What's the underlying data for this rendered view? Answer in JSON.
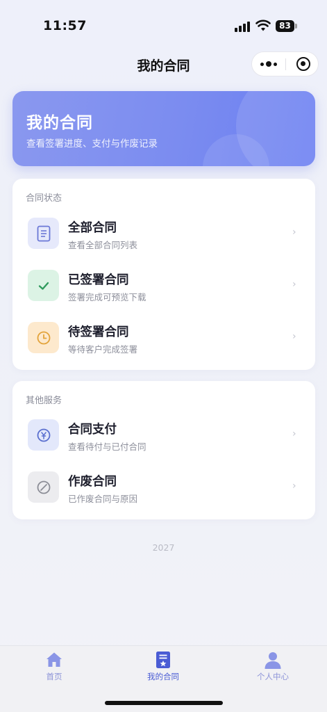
{
  "status_bar": {
    "time": "11:57",
    "battery": "83"
  },
  "nav": {
    "title": "我的合同"
  },
  "banner": {
    "title": "我的合同",
    "subtitle": "查看签署进度、支付与作废记录"
  },
  "contract_status": {
    "title": "合同状态",
    "items": [
      {
        "label": "全部合同",
        "desc": "查看全部合同列表",
        "icon": "document-icon",
        "color": "#6b78d6",
        "bg": "#e6e9fb"
      },
      {
        "label": "已签署合同",
        "desc": "签署完成可预览下载",
        "icon": "check-icon",
        "color": "#2f9a5d",
        "bg": "#dcf3e5"
      },
      {
        "label": "待签署合同",
        "desc": "等待客户完成签署",
        "icon": "clock-icon",
        "color": "#e3a33a",
        "bg": "#fde9cd"
      }
    ]
  },
  "other_services": {
    "title": "其他服务",
    "items": [
      {
        "label": "合同支付",
        "desc": "查看待付与已付合同",
        "icon": "yen-icon",
        "color": "#5a6fcf",
        "bg": "#e3e8fb"
      },
      {
        "label": "作废合同",
        "desc": "已作废合同与原因",
        "icon": "void-icon",
        "color": "#8b8d96",
        "bg": "#ececef"
      }
    ]
  },
  "footer": {
    "year": "2027"
  },
  "tabs": [
    {
      "label": "首页",
      "icon": "home-icon"
    },
    {
      "label": "我的合同",
      "icon": "contract-icon",
      "active": true
    },
    {
      "label": "个人中心",
      "icon": "user-icon"
    }
  ],
  "colors": {
    "accent": "#6a7ef2",
    "tab_active": "#4a5cd4",
    "tab_inactive": "#8e95d8"
  }
}
